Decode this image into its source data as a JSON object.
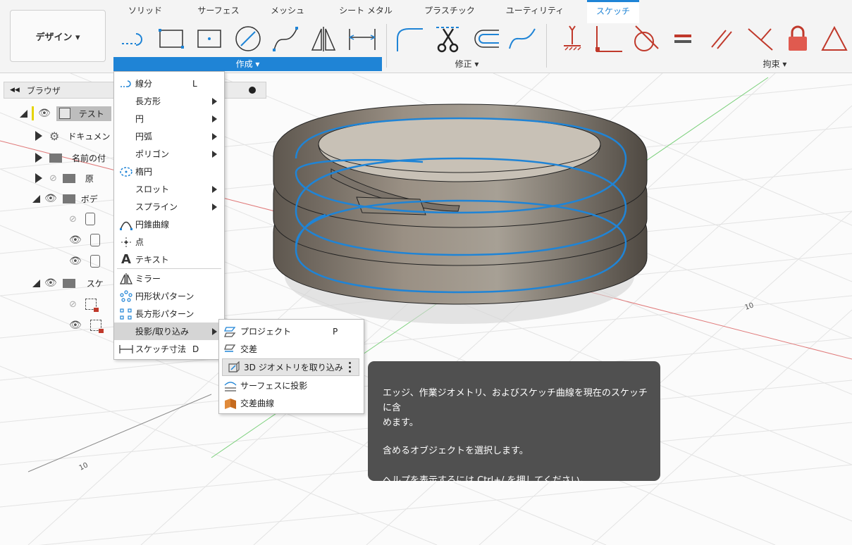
{
  "ribbon": {
    "design_label": "デザイン ▾",
    "tabs": [
      "ソリッド",
      "サーフェス",
      "メッシュ",
      "シート メタル",
      "プラスチック",
      "ユーティリティ",
      "スケッチ"
    ],
    "active_tab": "スケッチ",
    "accent_color": "#1f84d6",
    "groups": {
      "create": "作成 ▾",
      "modify": "修正 ▾",
      "constrain": "拘束 ▾"
    }
  },
  "browser": {
    "title": "ブラウザ",
    "items": [
      {
        "label": "テスト",
        "icon": "component-icon"
      },
      {
        "label": "ドキュメン",
        "icon": "gear-icon"
      },
      {
        "label": "名前の付",
        "icon": "folder-icon"
      },
      {
        "label": "原",
        "icon": "folder-icon"
      },
      {
        "label": "ボデ",
        "icon": "folder-icon"
      },
      {
        "label": "スケ",
        "icon": "folder-icon"
      }
    ]
  },
  "create_menu": {
    "items": [
      {
        "label": "線分",
        "shortcut": "L",
        "icon": "line-icon"
      },
      {
        "label": "長方形",
        "icon": "rectangle-icon",
        "submenu": true
      },
      {
        "label": "円",
        "icon": "circle-icon",
        "submenu": true
      },
      {
        "label": "円弧",
        "icon": "arc-icon",
        "submenu": true
      },
      {
        "label": "ポリゴン",
        "icon": "polygon-icon",
        "submenu": true
      },
      {
        "label": "楕円",
        "icon": "ellipse-icon"
      },
      {
        "label": "スロット",
        "icon": "slot-icon",
        "submenu": true
      },
      {
        "label": "スプライン",
        "icon": "spline-icon",
        "submenu": true
      },
      {
        "label": "円錐曲線",
        "icon": "conic-icon"
      },
      {
        "label": "点",
        "icon": "point-icon"
      },
      {
        "label": "テキスト",
        "icon": "text-icon"
      },
      {
        "label": "ミラー",
        "icon": "mirror-icon"
      },
      {
        "label": "円形状パターン",
        "icon": "circular-pattern-icon"
      },
      {
        "label": "長方形パターン",
        "icon": "rect-pattern-icon"
      },
      {
        "label": "投影/取り込み",
        "icon": "project-icon",
        "submenu": true,
        "highlighted": true
      },
      {
        "label": "スケッチ寸法",
        "shortcut": "D",
        "icon": "dimension-icon"
      }
    ]
  },
  "project_submenu": {
    "items": [
      {
        "label": "プロジェクト",
        "shortcut": "P",
        "icon": "project-icon"
      },
      {
        "label": "交差",
        "icon": "intersect-icon"
      },
      {
        "label": "3D ジオメトリを取り込み",
        "icon": "include-3d-icon",
        "highlighted": true
      },
      {
        "label": "サーフェスに投影",
        "icon": "project-to-surface-icon"
      },
      {
        "label": "交差曲線",
        "icon": "intersection-curve-icon"
      }
    ]
  },
  "tooltip": {
    "line1": "エッジ、作業ジオメトリ、およびスケッチ曲線を現在のスケッチに含",
    "line2": "めます。",
    "line3": "含めるオブジェクトを選択します。",
    "line4": "ヘルプを表示するには Ctrl+/ を押してください。"
  },
  "viewport": {
    "axis_labels": [
      "10",
      "10"
    ]
  }
}
